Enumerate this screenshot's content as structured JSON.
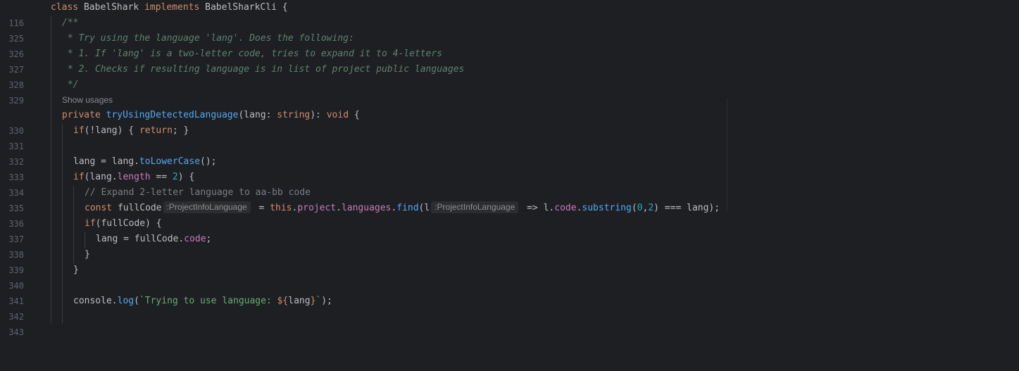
{
  "editor": {
    "sticky_line": {
      "number": "116",
      "tokens": [
        {
          "t": "class ",
          "c": "kw"
        },
        {
          "t": "BabelShark ",
          "c": "plain"
        },
        {
          "t": "implements ",
          "c": "kw"
        },
        {
          "t": "BabelSharkCli {",
          "c": "plain"
        }
      ]
    },
    "show_usages": "Show usages",
    "hints": {
      "fullcode_type": ":ProjectInfoLanguage",
      "l_type": ":ProjectInfoLanguage"
    },
    "lines": [
      {
        "number": "325",
        "tokens": [
          {
            "t": "/**",
            "c": "doc"
          }
        ]
      },
      {
        "number": "326",
        "tokens": [
          {
            "t": " * Try using the language 'lang'. Does the following:",
            "c": "doc"
          }
        ]
      },
      {
        "number": "327",
        "tokens": [
          {
            "t": " * 1. If 'lang' is a two-letter code, tries to expand it to 4-letters",
            "c": "doc"
          }
        ]
      },
      {
        "number": "328",
        "tokens": [
          {
            "t": " * 2. Checks if resulting language is in list of project public languages",
            "c": "doc"
          }
        ]
      },
      {
        "number": "329",
        "tokens": [
          {
            "t": " */",
            "c": "doc"
          }
        ]
      },
      {
        "number": "330",
        "tokens": [
          {
            "t": "private ",
            "c": "kw"
          },
          {
            "t": "tryUsingDetectedLanguage",
            "c": "fn"
          },
          {
            "t": "(lang: ",
            "c": "plain"
          },
          {
            "t": "string",
            "c": "kw"
          },
          {
            "t": "): ",
            "c": "plain"
          },
          {
            "t": "void",
            "c": "kw"
          },
          {
            "t": " {",
            "c": "plain"
          }
        ]
      },
      {
        "number": "331",
        "tokens": [
          {
            "t": "if",
            "c": "kw"
          },
          {
            "t": "(!lang) { ",
            "c": "plain"
          },
          {
            "t": "return",
            "c": "kw"
          },
          {
            "t": "; }",
            "c": "plain"
          }
        ]
      },
      {
        "number": "332",
        "tokens": []
      },
      {
        "number": "333",
        "tokens": [
          {
            "t": "lang = lang.",
            "c": "plain"
          },
          {
            "t": "toLowerCase",
            "c": "fn"
          },
          {
            "t": "();",
            "c": "plain"
          }
        ]
      },
      {
        "number": "334",
        "tokens": [
          {
            "t": "if",
            "c": "kw"
          },
          {
            "t": "(lang.",
            "c": "plain"
          },
          {
            "t": "length",
            "c": "prop"
          },
          {
            "t": " == ",
            "c": "plain"
          },
          {
            "t": "2",
            "c": "num"
          },
          {
            "t": ") {",
            "c": "plain"
          }
        ]
      },
      {
        "number": "335",
        "tokens": [
          {
            "t": "// Expand 2-letter language to aa-bb code",
            "c": "cmt"
          }
        ]
      },
      {
        "number": "336",
        "tokens": [
          {
            "t": "const ",
            "c": "kw"
          },
          {
            "t": "fullCode",
            "c": "plain"
          },
          {
            "hint": "fullcode_type"
          },
          {
            "t": " = ",
            "c": "plain"
          },
          {
            "t": "this",
            "c": "kw"
          },
          {
            "t": ".",
            "c": "plain"
          },
          {
            "t": "project",
            "c": "prop"
          },
          {
            "t": ".",
            "c": "plain"
          },
          {
            "t": "languages",
            "c": "prop"
          },
          {
            "t": ".",
            "c": "plain"
          },
          {
            "t": "find",
            "c": "fn"
          },
          {
            "t": "(l",
            "c": "plain"
          },
          {
            "hint": "l_type"
          },
          {
            "t": " => l.",
            "c": "plain"
          },
          {
            "t": "code",
            "c": "prop"
          },
          {
            "t": ".",
            "c": "plain"
          },
          {
            "t": "substring",
            "c": "fn"
          },
          {
            "t": "(",
            "c": "plain"
          },
          {
            "t": "0",
            "c": "num"
          },
          {
            "t": ",",
            "c": "plain"
          },
          {
            "t": "2",
            "c": "num"
          },
          {
            "t": ") === lang);",
            "c": "plain"
          }
        ]
      },
      {
        "number": "337",
        "tokens": [
          {
            "t": "if",
            "c": "kw"
          },
          {
            "t": "(fullCode) {",
            "c": "plain"
          }
        ]
      },
      {
        "number": "338",
        "tokens": [
          {
            "t": "lang = fullCode.",
            "c": "plain"
          },
          {
            "t": "code",
            "c": "prop"
          },
          {
            "t": ";",
            "c": "plain"
          }
        ]
      },
      {
        "number": "339",
        "tokens": [
          {
            "t": "}",
            "c": "plain"
          }
        ]
      },
      {
        "number": "340",
        "tokens": [
          {
            "t": "}",
            "c": "plain"
          }
        ]
      },
      {
        "number": "341",
        "tokens": []
      },
      {
        "number": "342",
        "tokens": [
          {
            "t": "console.",
            "c": "plain"
          },
          {
            "t": "log",
            "c": "fn"
          },
          {
            "t": "(",
            "c": "plain"
          },
          {
            "t": "`Trying to use language: ",
            "c": "str"
          },
          {
            "t": "${",
            "c": "kw"
          },
          {
            "t": "lang",
            "c": "plain"
          },
          {
            "t": "}",
            "c": "kw"
          },
          {
            "t": "`",
            "c": "str"
          },
          {
            "t": ");",
            "c": "plain"
          }
        ]
      },
      {
        "number": "343",
        "tokens": []
      }
    ]
  }
}
